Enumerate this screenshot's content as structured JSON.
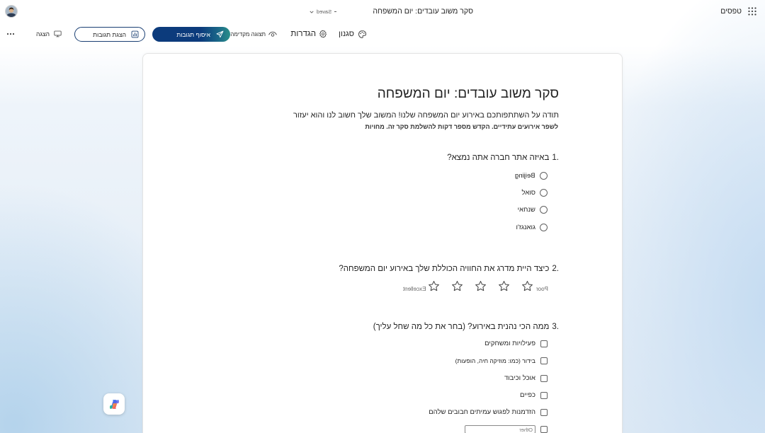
{
  "header": {
    "app_name": "טפסים",
    "form_title": "סקר משוב עובדים: יום המשפחה",
    "save_status": "Saved"
  },
  "toolbar": {
    "style_label": "סגנון",
    "settings_label": "הגדרות",
    "preview_label": "תצוגה מקדימה",
    "collect_label": "איסוף תגובות",
    "view_responses_label": "הצגת תגובות",
    "present_label": "הצגה"
  },
  "form": {
    "title": "סקר משוב עובדים: יום המשפחה",
    "description_line1": "תודה על השתתפותכם באירוע יום המשפחה שלנו! המשוב שלך חשוב לנו והוא יעזור",
    "description_line2": "לשפר אירועים עתידיים. הקדש מספר דקות להשלמת סקר זה. מחויות",
    "questions": [
      {
        "number": "1.",
        "text": "באיזה אתר חברה אתה נמצא?",
        "options": [
          "Beijing",
          "סואל",
          "שנחאי",
          "גואנגז'ו"
        ]
      },
      {
        "number": "2.",
        "text": "כיצד היית מדרג את החוויה הכוללת שלך באירוע יום המשפחה?",
        "star_count": 5,
        "low_label": "Poor",
        "high_label": "Excellent"
      },
      {
        "number": "3.",
        "text": "ממה הכי נהנית באירוע? (בחר את כל מה שחל עליך)",
        "options": [
          "פעילויות ומשחקים",
          "בידור (כמו: מוזיקה חיה, הופעות)",
          "אוכל וכיבוד",
          "כפיים",
          "הזדמנות לפגוש עמיתים חבובים שלהם"
        ],
        "other_placeholder": "Other"
      }
    ]
  },
  "icons": {
    "app_launcher": "waffle-icon",
    "account": "avatar",
    "save_menu": "chevron-down-icon",
    "style": "palette-icon",
    "settings": "gear-icon",
    "preview": "eye-icon",
    "collect": "send-icon",
    "view_responses": "chart-icon",
    "present": "monitor-icon",
    "more": "more-icon",
    "rating": "star-icon",
    "assistant": "copilot-icon"
  },
  "colors": {
    "primary": "#0c3b7c",
    "primary_end": "#2a8f8a",
    "text": "#242424",
    "card": "#ffffff"
  }
}
